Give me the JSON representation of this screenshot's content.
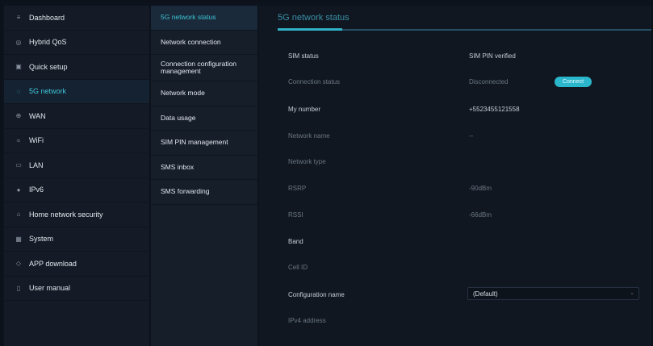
{
  "nav": {
    "items": [
      {
        "label": "Dashboard",
        "icon": "≡",
        "active": false
      },
      {
        "label": "Hybrid QoS",
        "icon": "◎",
        "active": false
      },
      {
        "label": "Quick setup",
        "icon": "▣",
        "active": false
      },
      {
        "label": "5G network",
        "icon": "◌",
        "active": true
      },
      {
        "label": "WAN",
        "icon": "⊕",
        "active": false
      },
      {
        "label": "WiFi",
        "icon": "≈",
        "active": false
      },
      {
        "label": "LAN",
        "icon": "▭",
        "active": false
      },
      {
        "label": "IPv6",
        "icon": "●",
        "active": false
      },
      {
        "label": "Home network security",
        "icon": "⌂",
        "active": false
      },
      {
        "label": "System",
        "icon": "▦",
        "active": false
      },
      {
        "label": "APP download",
        "icon": "◇",
        "active": false
      },
      {
        "label": "User manual",
        "icon": "▯",
        "active": false
      }
    ]
  },
  "submenu": {
    "items": [
      {
        "label": "5G network status",
        "active": true
      },
      {
        "label": "Network connection",
        "active": false
      },
      {
        "label": "Connection configuration management",
        "active": false
      },
      {
        "label": "Network mode",
        "active": false
      },
      {
        "label": "Data usage",
        "active": false
      },
      {
        "label": "SIM PIN management",
        "active": false
      },
      {
        "label": "SMS inbox",
        "active": false
      },
      {
        "label": "SMS forwarding",
        "active": false
      }
    ]
  },
  "main": {
    "title": "5G network status",
    "fields": {
      "sim_status": {
        "label": "SIM status",
        "value": "SIM PIN verified"
      },
      "connection_status": {
        "label": "Connection status",
        "value": "Disconnected",
        "button": "Connect"
      },
      "my_number": {
        "label": "My number",
        "value": "+5523455121558"
      },
      "network_name": {
        "label": "Network name",
        "value": "--"
      },
      "network_type": {
        "label": "Network type",
        "value": ""
      },
      "rsrp": {
        "label": "RSRP",
        "value": "-90dBm"
      },
      "rssi": {
        "label": "RSSI",
        "value": "-66dBm"
      },
      "band": {
        "label": "Band",
        "value": ""
      },
      "cell_id": {
        "label": "Cell ID",
        "value": ""
      },
      "configuration_name": {
        "label": "Configuration name",
        "value": "(Default)"
      },
      "ipv4_address": {
        "label": "IPv4 address",
        "value": ""
      }
    }
  },
  "colors": {
    "accent": "#3ec3d6",
    "button": "#2ab7cc",
    "background": "#0d131c"
  }
}
